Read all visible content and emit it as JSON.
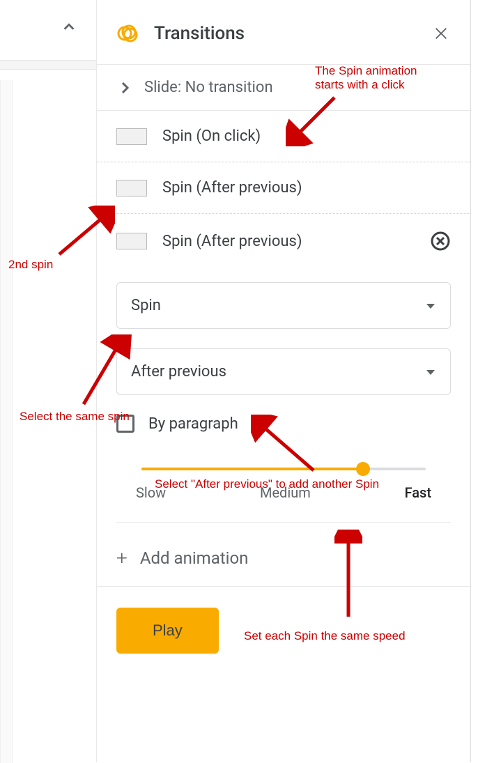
{
  "header": {
    "title": "Transitions"
  },
  "slide_row": {
    "label": "Slide: No transition"
  },
  "animations": [
    {
      "label": "Spin  (On click)"
    },
    {
      "label": "Spin  (After previous)"
    },
    {
      "label": "Spin  (After previous)"
    }
  ],
  "editor": {
    "animation_select": "Spin",
    "trigger_select": "After previous",
    "by_paragraph_label": "By paragraph",
    "speed": {
      "slow": "Slow",
      "medium": "Medium",
      "fast": "Fast",
      "fill_pct": 78
    }
  },
  "add_animation_label": "Add animation",
  "play_label": "Play",
  "annotations": {
    "a1": "The Spin animation\nstarts with a click",
    "a2": "2nd spin",
    "a3": "Select the same spin",
    "a4": "Select \"After previous\" to add another Spin",
    "a5": "Set each Spin the same speed"
  }
}
